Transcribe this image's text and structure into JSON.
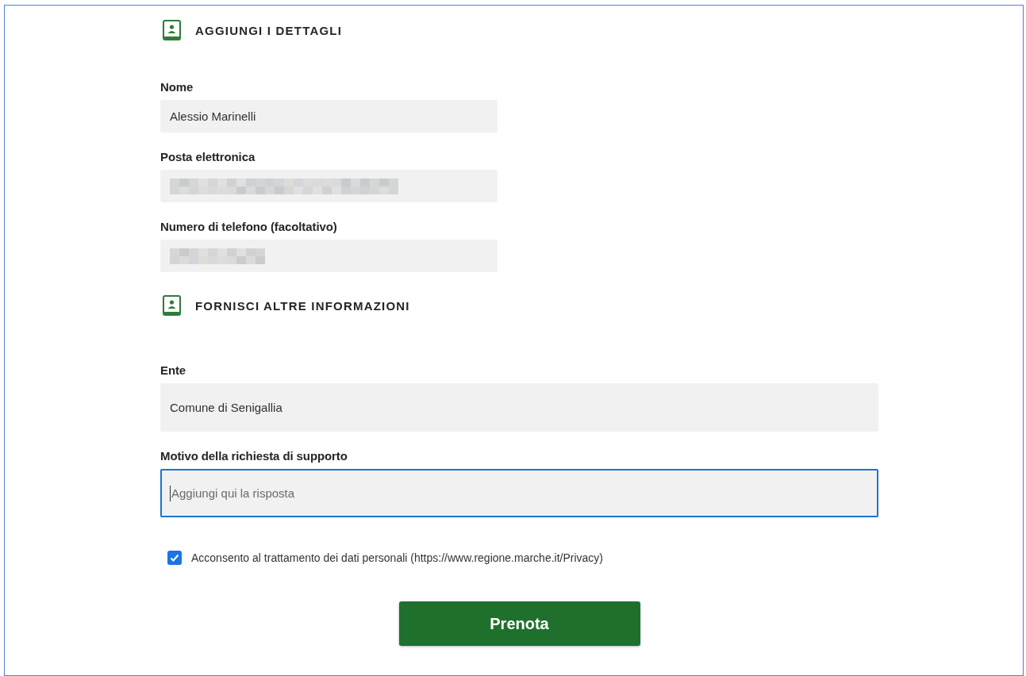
{
  "sections": [
    {
      "title": "AGGIUNGI I DETTAGLI",
      "fields": [
        {
          "label": "Nome",
          "kind": "short",
          "value": "Alessio Marinelli",
          "focused": false
        },
        {
          "label": "Posta elettronica",
          "kind": "email",
          "focused": false
        },
        {
          "label": "Numero di telefono (facoltativo)",
          "kind": "phone",
          "focused": false
        }
      ]
    },
    {
      "title": "FORNISCI ALTRE INFORMAZIONI",
      "fields": [
        {
          "label": "Ente",
          "kind": "wide",
          "value": "Comune di Senigallia",
          "focused": false
        },
        {
          "label": "Motivo della richiesta di supporto",
          "kind": "wide",
          "placeholder": "Aggiungi qui la risposta",
          "focused": true
        }
      ]
    }
  ],
  "consent": {
    "label": "Acconsento al trattamento dei dati personali (https://www.regione.marche.it/Privacy)",
    "checked": true
  },
  "submit_button": {
    "label": "Prenota"
  }
}
